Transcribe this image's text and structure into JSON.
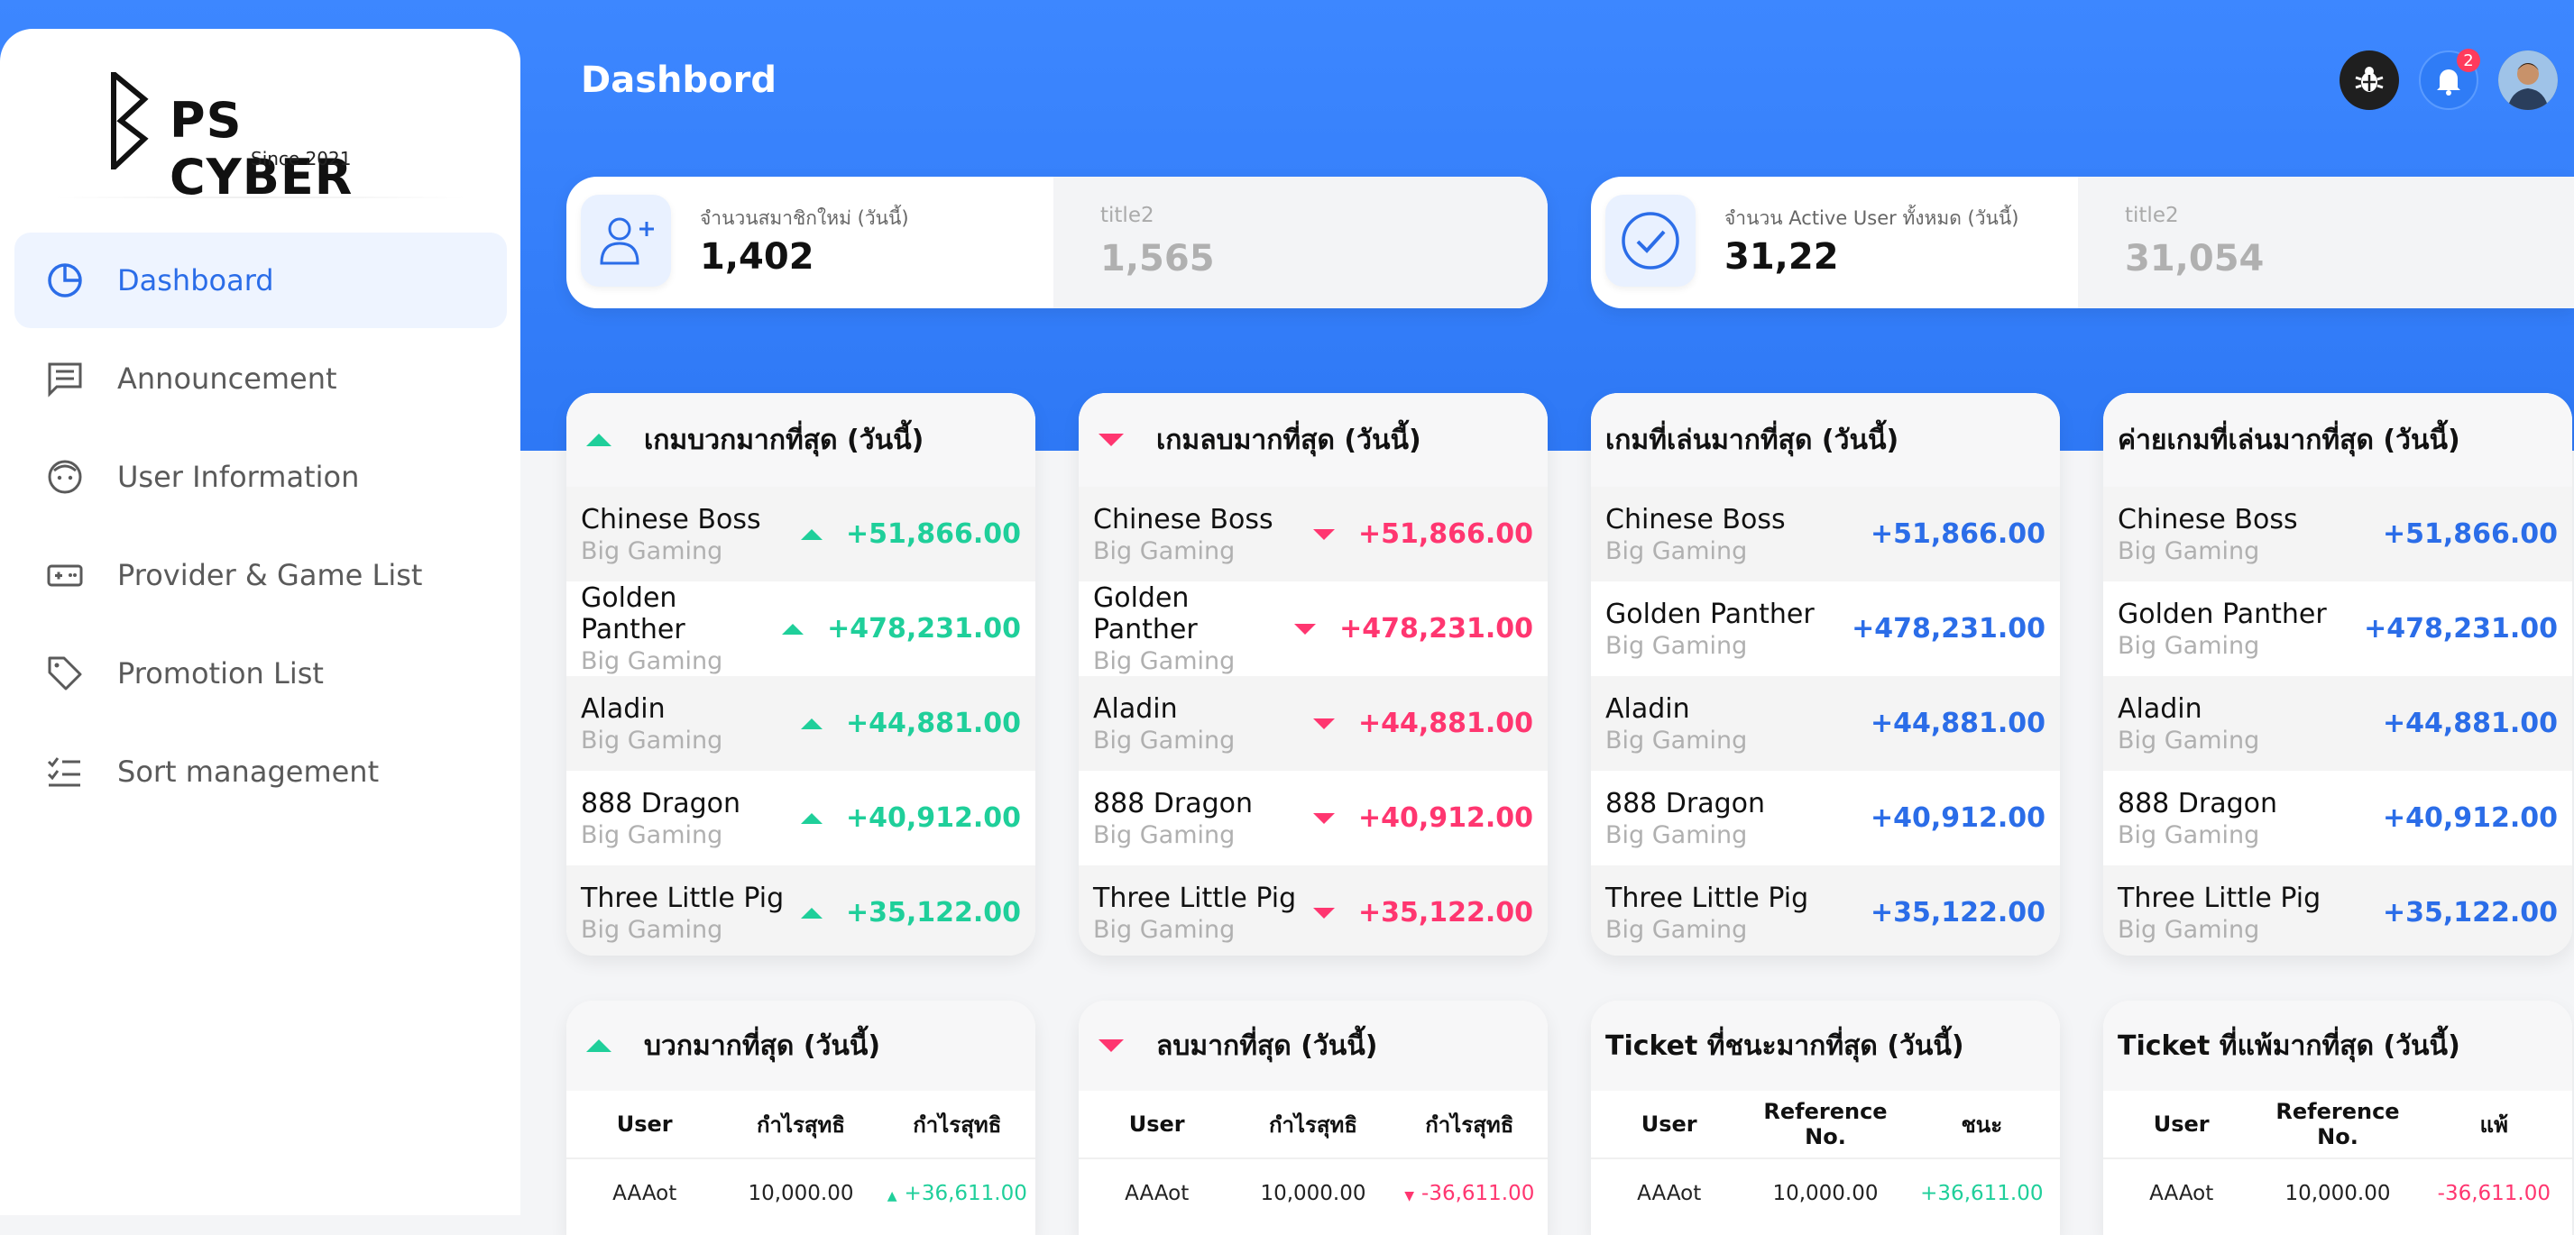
{
  "app": {
    "brand": "PS CYBER",
    "since": "Since 2021",
    "page_title": "Dashbord",
    "notification_count": "2"
  },
  "sidebar": {
    "items": [
      {
        "label": "Dashboard",
        "icon": "pie-chart-icon",
        "active": true
      },
      {
        "label": "Announcement",
        "icon": "message-icon",
        "active": false
      },
      {
        "label": "User Information",
        "icon": "user-face-icon",
        "active": false
      },
      {
        "label": "Provider & Game List",
        "icon": "gamepad-icon",
        "active": false
      },
      {
        "label": "Promotion List",
        "icon": "tag-icon",
        "active": false
      },
      {
        "label": "Sort management",
        "icon": "checklist-icon",
        "active": false
      }
    ]
  },
  "stats": [
    {
      "label": "จำนวนสมาชิกใหม่ (วันนี้)",
      "value": "1,402",
      "title2": "title2",
      "value2": "1,565",
      "icon": "add-user-icon"
    },
    {
      "label": "จำนวน Active User ทั้งหมด (วันนี้)",
      "value": "31,22",
      "title2": "title2",
      "value2": "31,054",
      "icon": "check-circle-icon"
    }
  ],
  "panels": [
    {
      "title": "เกมบวกมากที่สุด (วันนี้)",
      "kind": "up",
      "rows": [
        {
          "name": "Chinese Boss",
          "provider": "Big Gaming",
          "value": "+51,866.00"
        },
        {
          "name": "Golden Panther",
          "provider": "Big Gaming",
          "value": "+478,231.00"
        },
        {
          "name": "Aladin",
          "provider": "Big Gaming",
          "value": "+44,881.00"
        },
        {
          "name": "888 Dragon",
          "provider": "Big Gaming",
          "value": "+40,912.00"
        },
        {
          "name": "Three Little Pig",
          "provider": "Big Gaming",
          "value": "+35,122.00"
        }
      ]
    },
    {
      "title": "เกมลบมากที่สุด (วันนี้)",
      "kind": "down",
      "rows": [
        {
          "name": "Chinese Boss",
          "provider": "Big Gaming",
          "value": "+51,866.00"
        },
        {
          "name": "Golden Panther",
          "provider": "Big Gaming",
          "value": "+478,231.00"
        },
        {
          "name": "Aladin",
          "provider": "Big Gaming",
          "value": "+44,881.00"
        },
        {
          "name": "888 Dragon",
          "provider": "Big Gaming",
          "value": "+40,912.00"
        },
        {
          "name": "Three Little Pig",
          "provider": "Big Gaming",
          "value": "+35,122.00"
        }
      ]
    },
    {
      "title": "เกมที่เล่นมากที่สุด (วันนี้)",
      "kind": "blue",
      "rows": [
        {
          "name": "Chinese Boss",
          "provider": "Big Gaming",
          "value": "+51,866.00"
        },
        {
          "name": "Golden Panther",
          "provider": "Big Gaming",
          "value": "+478,231.00"
        },
        {
          "name": "Aladin",
          "provider": "Big Gaming",
          "value": "+44,881.00"
        },
        {
          "name": "888 Dragon",
          "provider": "Big Gaming",
          "value": "+40,912.00"
        },
        {
          "name": "Three Little Pig",
          "provider": "Big Gaming",
          "value": "+35,122.00"
        }
      ]
    },
    {
      "title": "ค่ายเกมที่เล่นมากที่สุด (วันนี้)",
      "kind": "blue",
      "rows": [
        {
          "name": "Chinese Boss",
          "provider": "Big Gaming",
          "value": "+51,866.00"
        },
        {
          "name": "Golden Panther",
          "provider": "Big Gaming",
          "value": "+478,231.00"
        },
        {
          "name": "Aladin",
          "provider": "Big Gaming",
          "value": "+44,881.00"
        },
        {
          "name": "888 Dragon",
          "provider": "Big Gaming",
          "value": "+40,912.00"
        },
        {
          "name": "Three Little Pig",
          "provider": "Big Gaming",
          "value": "+35,122.00"
        }
      ]
    }
  ],
  "tables": [
    {
      "title": "บวกมากที่สุด (วันนี้)",
      "kind": "up",
      "headers": [
        "User",
        "กำไรสุทธิ",
        "กำไรสุทธิ"
      ],
      "rows": [
        [
          "AAAot",
          "10,000.00",
          "+36,611.00"
        ]
      ]
    },
    {
      "title": "ลบมากที่สุด (วันนี้)",
      "kind": "down",
      "headers": [
        "User",
        "กำไรสุทธิ",
        "กำไรสุทธิ"
      ],
      "rows": [
        [
          "AAAot",
          "10,000.00",
          "-36,611.00"
        ]
      ]
    },
    {
      "title": "Ticket ที่ชนะมากที่สุด (วันนี้)",
      "kind": "win",
      "headers": [
        "User",
        "Reference No.",
        "ชนะ"
      ],
      "rows": [
        [
          "AAAot",
          "10,000.00",
          "+36,611.00"
        ]
      ]
    },
    {
      "title": "Ticket ที่แพ้มากที่สุด (วันนี้)",
      "kind": "lose",
      "headers": [
        "User",
        "Reference No.",
        "แพ้"
      ],
      "rows": [
        [
          "AAAot",
          "10,000.00",
          "-36,611.00"
        ]
      ]
    }
  ],
  "colors": {
    "accent": "#2b6de8",
    "positive": "#1fcf9a",
    "negative": "#ff3670",
    "hero": "#3d87ff"
  }
}
